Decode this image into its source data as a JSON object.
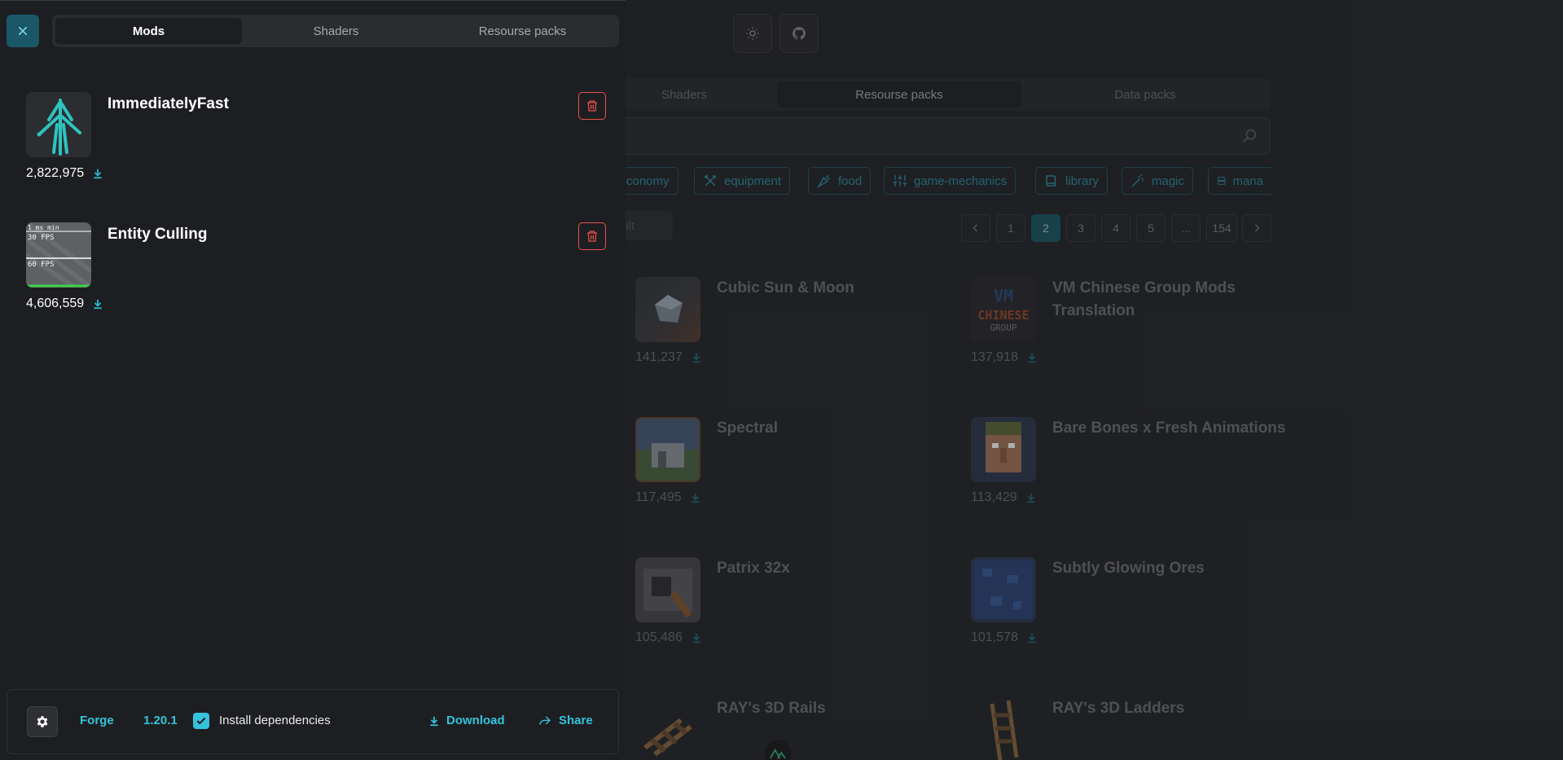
{
  "drawer": {
    "tabs": [
      {
        "label": "Mods",
        "active": true
      },
      {
        "label": "Shaders",
        "active": false
      },
      {
        "label": "Resourse packs",
        "active": false
      }
    ],
    "mods": [
      {
        "name": "ImmediatelyFast",
        "downloads": "2,822,975",
        "icon": "arrow-logo-icon"
      },
      {
        "name": "Entity Culling",
        "downloads": "4,606,559",
        "icon": "fps-graph-icon",
        "thumb_text": [
          "1 ms min",
          "30 FPS",
          "60 FPS"
        ]
      }
    ],
    "footer": {
      "loader": "Forge",
      "version": "1.20.1",
      "install_dependencies_label": "Install dependencies",
      "install_dependencies_checked": true,
      "download_label": "Download",
      "share_label": "Share"
    }
  },
  "background": {
    "tabs": [
      {
        "label": "Shaders",
        "active": false
      },
      {
        "label": "Resourse packs",
        "active": true
      },
      {
        "label": "Data packs",
        "active": false
      }
    ],
    "tags": [
      "conomy",
      "equipment",
      "food",
      "game-mechanics",
      "library",
      "magic",
      "mana"
    ],
    "sort_label": "uilt",
    "pagination": [
      "1",
      "2",
      "3",
      "4",
      "5",
      "...",
      "154"
    ],
    "current_page": "2",
    "cards": [
      {
        "title": "Cubic Sun & Moon",
        "downloads": "141,237"
      },
      {
        "title": "VM Chinese Group Mods Translation",
        "downloads": "137,918"
      },
      {
        "title": "Spectral",
        "downloads": "117,495"
      },
      {
        "title": "Bare Bones x Fresh Animations",
        "downloads": "113,429"
      },
      {
        "title": "Patrix 32x",
        "downloads": "105,486"
      },
      {
        "title": "Subtly Glowing Ores",
        "downloads": "101,578"
      },
      {
        "title": "RAY's 3D Rails",
        "downloads": ""
      },
      {
        "title": "RAY's 3D Ladders",
        "downloads": ""
      }
    ],
    "vm_logo_text": [
      "VM",
      "CHINESE",
      "GROUP"
    ]
  },
  "colors": {
    "accent": "#33c4dc",
    "danger": "#e2514d",
    "drawer_bg": "#1d1e21",
    "page_bg": "#26272a"
  }
}
